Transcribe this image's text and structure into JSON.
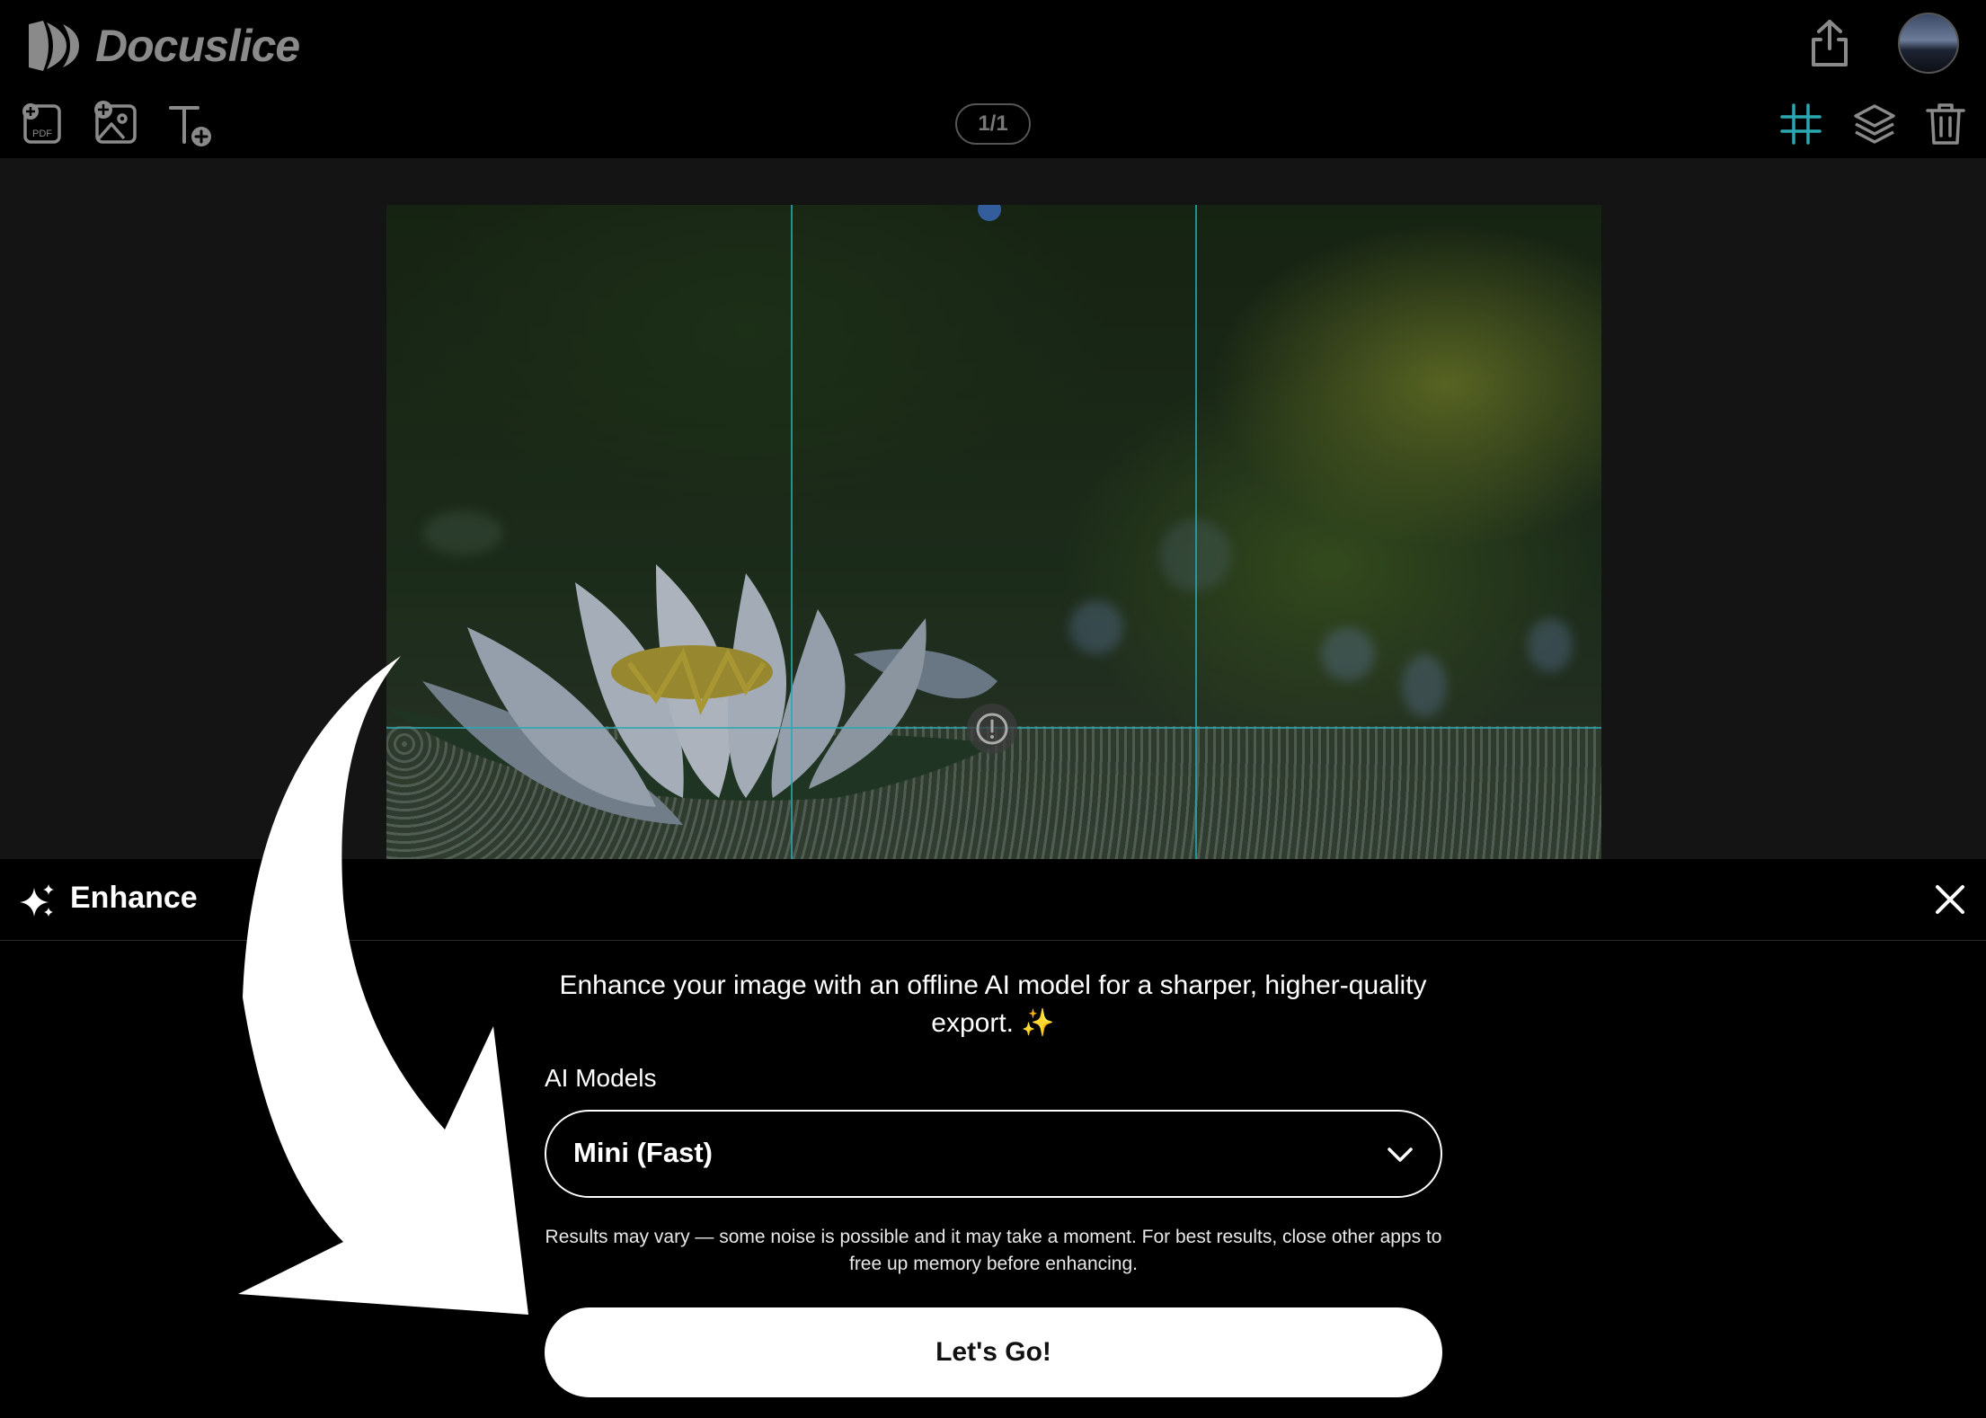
{
  "app": {
    "name": "Docuslice"
  },
  "toolbar": {
    "page_indicator": "1/1",
    "add_pdf_badge": "PDF"
  },
  "enhance_panel": {
    "title": "Enhance",
    "description": "Enhance your image with an offline AI model for a sharper, higher-quality export. ✨",
    "models_label": "AI Models",
    "selected_model": "Mini (Fast)",
    "note": "Results may vary — some noise is possible and it may take a moment. For best results, close other apps to free up memory before enhancing.",
    "go_label": "Let's Go!"
  },
  "colors": {
    "accent_grid": "#2aa7b0",
    "panel_bg": "#000000",
    "canvas_bg": "#141414"
  },
  "icons": {
    "logo": "docuslice-logo-icon",
    "export": "share-upload-icon",
    "add_pdf": "add-pdf-icon",
    "add_image": "add-image-icon",
    "add_text": "add-text-icon",
    "grid": "grid-icon",
    "layers": "layers-icon",
    "delete": "trash-icon",
    "info": "info-icon",
    "enhance": "sparkle-icon",
    "close": "close-icon",
    "dropdown": "chevron-down-icon"
  }
}
